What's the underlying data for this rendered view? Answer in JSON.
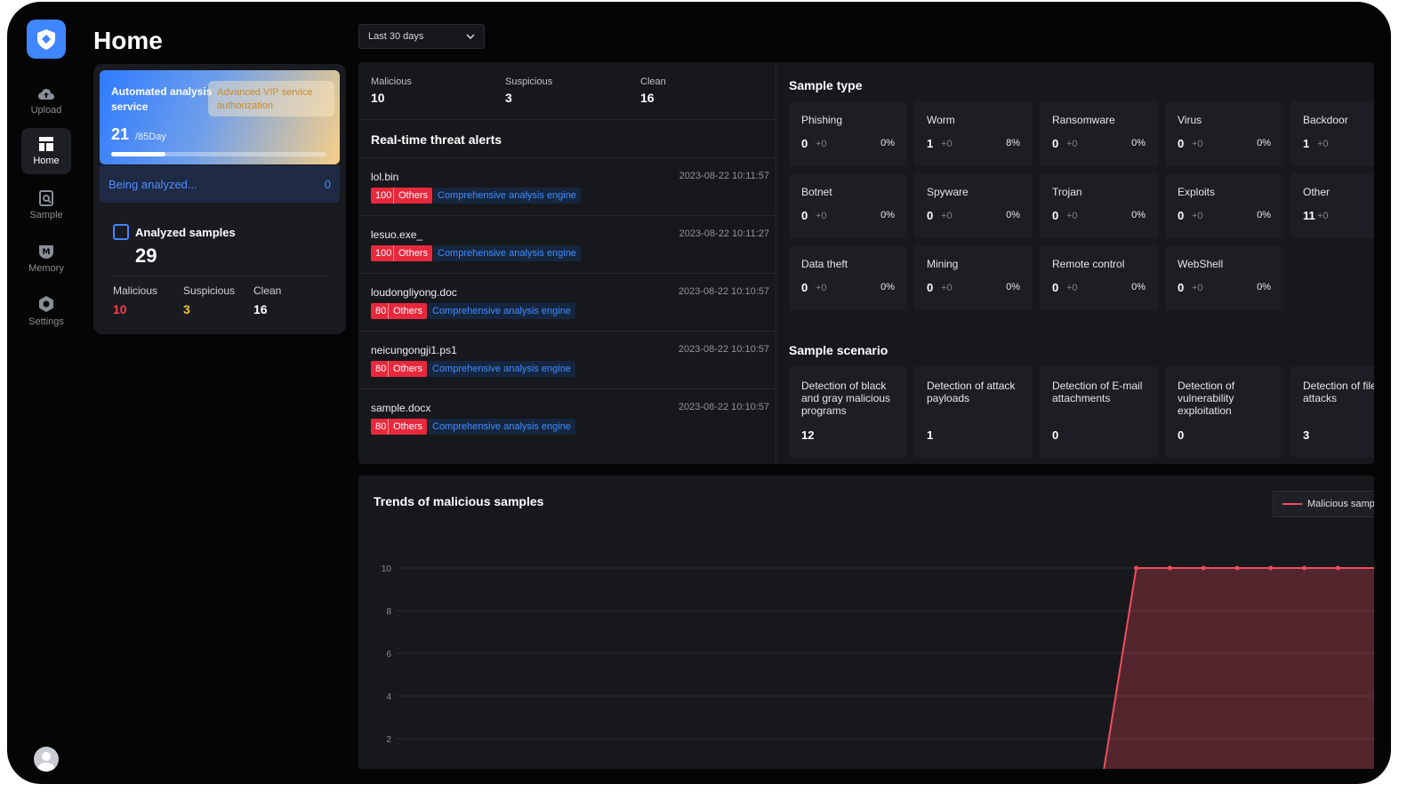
{
  "sidebar": {
    "items": [
      {
        "label": "Upload",
        "icon": "cloud-upload-icon"
      },
      {
        "label": "Home",
        "icon": "home-icon"
      },
      {
        "label": "Sample",
        "icon": "sample-icon"
      },
      {
        "label": "Memory",
        "icon": "memory-icon"
      },
      {
        "label": "Settings",
        "icon": "settings-icon"
      }
    ]
  },
  "header": {
    "title": "Home",
    "range_select": "Last 30 days"
  },
  "service": {
    "title": "Automated analysis service",
    "badge": "Advanced VIP service authorization",
    "used": "21",
    "per": "/85Day",
    "progress": 0.25,
    "being_label": "Being analyzed...",
    "being_count": "0"
  },
  "analyzed": {
    "label": "Analyzed samples",
    "total": "29",
    "stats": [
      {
        "label": "Malicious",
        "value": "10",
        "color": "#ff3b4e"
      },
      {
        "label": "Suspicious",
        "value": "3",
        "color": "#f5c53a"
      },
      {
        "label": "Clean",
        "value": "16",
        "color": "#ffffff"
      }
    ]
  },
  "summary": [
    {
      "label": "Malicious",
      "value": "10"
    },
    {
      "label": "Suspicious",
      "value": "3"
    },
    {
      "label": "Clean",
      "value": "16"
    }
  ],
  "alerts": {
    "title": "Real-time threat alerts",
    "rows": [
      {
        "name": "lol.bin",
        "time": "2023-08-22 10:11:57",
        "score": "100",
        "type": "Others",
        "engine": "Comprehensive analysis engine"
      },
      {
        "name": "lesuo.exe_",
        "time": "2023-08-22 10:11:27",
        "score": "100",
        "type": "Others",
        "engine": "Comprehensive analysis engine"
      },
      {
        "name": "loudongliyong.doc",
        "time": "2023-08-22 10:10:57",
        "score": "80",
        "type": "Others",
        "engine": "Comprehensive analysis engine"
      },
      {
        "name": "neicungongji1.ps1",
        "time": "2023-08-22 10:10:57",
        "score": "80",
        "type": "Others",
        "engine": "Comprehensive analysis engine"
      },
      {
        "name": "sample.docx",
        "time": "2023-08-22 10:10:57",
        "score": "80",
        "type": "Others",
        "engine": "Comprehensive analysis engine"
      }
    ]
  },
  "sample_types": {
    "title": "Sample type",
    "items": [
      {
        "name": "Phishing",
        "count": "0",
        "delta": "+0",
        "pct": "0%"
      },
      {
        "name": "Worm",
        "count": "1",
        "delta": "+0",
        "pct": "8%"
      },
      {
        "name": "Ransomware",
        "count": "0",
        "delta": "+0",
        "pct": "0%"
      },
      {
        "name": "Virus",
        "count": "0",
        "delta": "+0",
        "pct": "0%"
      },
      {
        "name": "Backdoor",
        "count": "1",
        "delta": "+0",
        "pct": ""
      },
      {
        "name": "Botnet",
        "count": "0",
        "delta": "+0",
        "pct": "0%"
      },
      {
        "name": "Spyware",
        "count": "0",
        "delta": "+0",
        "pct": "0%"
      },
      {
        "name": "Trojan",
        "count": "0",
        "delta": "+0",
        "pct": "0%"
      },
      {
        "name": "Exploits",
        "count": "0",
        "delta": "+0",
        "pct": "0%"
      },
      {
        "name": "Other",
        "count": "11",
        "delta": "+0",
        "pct": ""
      },
      {
        "name": "Data theft",
        "count": "0",
        "delta": "+0",
        "pct": "0%"
      },
      {
        "name": "Mining",
        "count": "0",
        "delta": "+0",
        "pct": "0%"
      },
      {
        "name": "Remote control",
        "count": "0",
        "delta": "+0",
        "pct": "0%"
      },
      {
        "name": "WebShell",
        "count": "0",
        "delta": "+0",
        "pct": "0%"
      }
    ]
  },
  "scenarios": {
    "title": "Sample scenario",
    "items": [
      {
        "name": "Detection of black and gray malicious programs",
        "value": "12"
      },
      {
        "name": "Detection of attack payloads",
        "value": "1"
      },
      {
        "name": "Detection of E-mail attachments",
        "value": "0"
      },
      {
        "name": "Detection of vulnerability exploitation",
        "value": "0"
      },
      {
        "name": "Detection of fileless attacks",
        "value": "3"
      }
    ]
  },
  "trend": {
    "title": "Trends of malicious samples",
    "legend": "Malicious samp"
  },
  "chart_data": {
    "type": "area",
    "title": "Trends of malicious samples",
    "yticks": [
      "2",
      "4",
      "6",
      "8",
      "10"
    ],
    "ylim": [
      0,
      10
    ],
    "series": [
      {
        "name": "Malicious samp",
        "color": "#f04d5c",
        "values": [
          0.2,
          0.2,
          0.2,
          0.2,
          0.2,
          0.2,
          0.2,
          10,
          10,
          10,
          10,
          10,
          10,
          10
        ]
      }
    ],
    "grid": true,
    "legend": "top-right"
  }
}
